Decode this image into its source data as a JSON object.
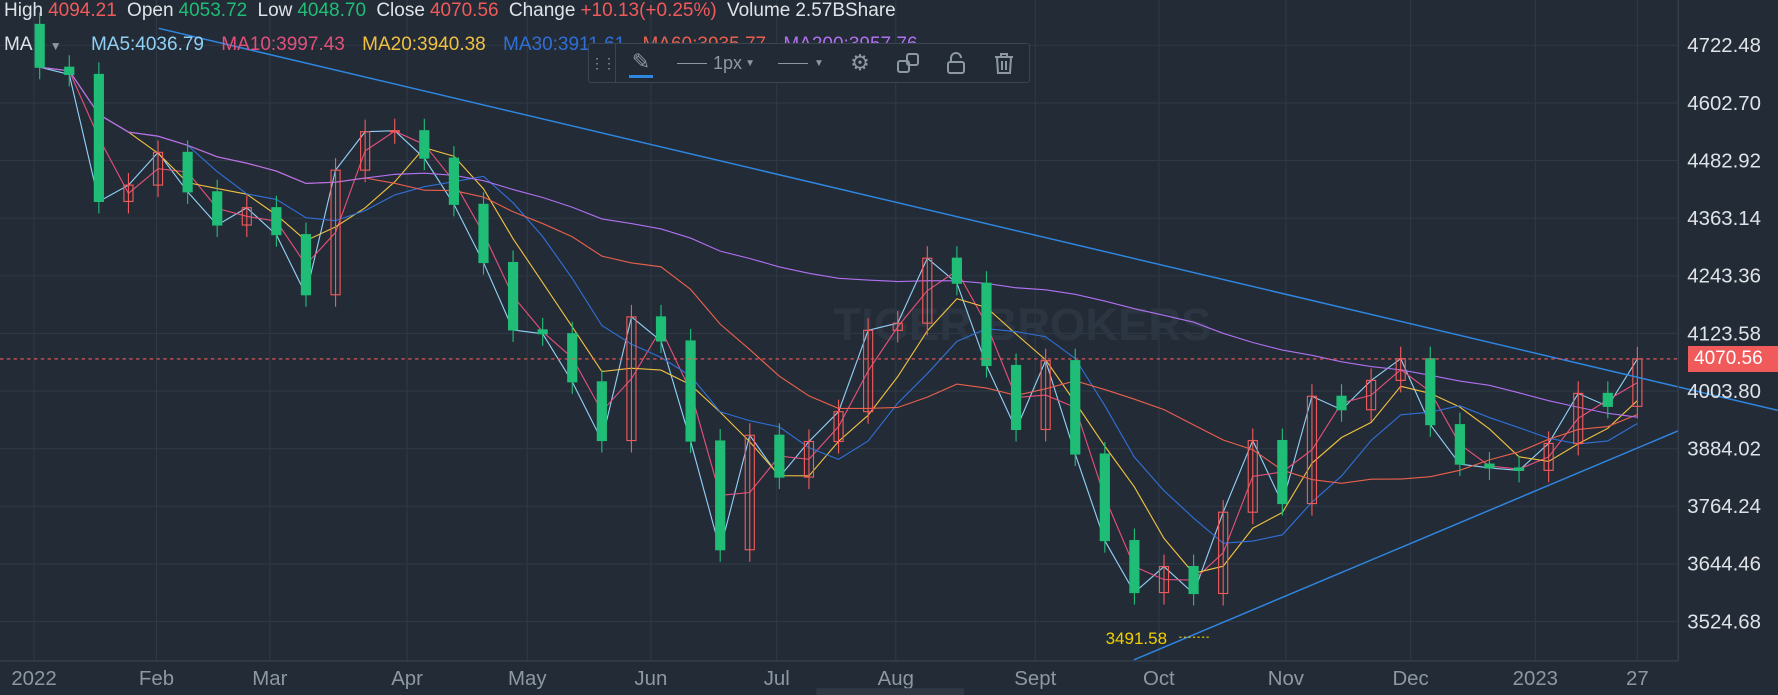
{
  "header": {
    "high_label": "High",
    "high": "4094.21",
    "open_label": "Open",
    "open": "4053.72",
    "low_label": "Low",
    "low": "4048.70",
    "close_label": "Close",
    "close": "4070.56",
    "change_label": "Change",
    "change": "+10.13(+0.25%)",
    "volume_label": "Volume",
    "volume": "2.57BShare"
  },
  "ma_bar": {
    "label": "MA",
    "items": [
      {
        "text": "MA5:4036.79",
        "color": "#8fd0f5"
      },
      {
        "text": "MA10:3997.43",
        "color": "#e2507a"
      },
      {
        "text": "MA20:3940.38",
        "color": "#f0c040"
      },
      {
        "text": "MA30:3911.61",
        "color": "#2f6fd6"
      },
      {
        "text": "MA60:3935.77",
        "color": "#e8604c"
      },
      {
        "text": "MA200:3957.76",
        "color": "#b070f0"
      }
    ]
  },
  "toolbar": {
    "width_label": "1px",
    "icons": [
      "drag-handle",
      "pencil",
      "line-width",
      "line-style",
      "gear",
      "clone",
      "lock",
      "trash"
    ]
  },
  "watermark": "TIGER BROKERS",
  "chart_data": {
    "type": "candlestick",
    "title": "",
    "yticks": [
      "4722.48",
      "4602.70",
      "4482.92",
      "4363.14",
      "4243.36",
      "4123.58",
      "4003.80",
      "3884.02",
      "3764.24",
      "3644.46",
      "3524.68"
    ],
    "ylim": [
      3460,
      4760
    ],
    "xticks": [
      "2022",
      "Feb",
      "Mar",
      "Apr",
      "May",
      "Jun",
      "Jul",
      "Aug",
      "Sept",
      "Oct",
      "Nov",
      "Dec",
      "2023",
      "27"
    ],
    "current_price": "4070.56",
    "low_annotation": "3491.58",
    "closes": [
      4677,
      4662,
      4398,
      4432,
      4500,
      4418,
      4349,
      4385,
      4329,
      4204,
      4463,
      4543,
      4545,
      4488,
      4392,
      4271,
      4131,
      4123,
      4023,
      3901,
      4158,
      4108,
      3900,
      3674,
      3912,
      3825,
      3899,
      3961,
      4130,
      4145,
      4280,
      4228,
      4057,
      3924,
      4067,
      3873,
      3693,
      3585,
      3639,
      3583,
      3752,
      3901,
      3770,
      3993,
      3965,
      4026,
      4071,
      3934,
      3852,
      3844,
      3839,
      3895,
      3999,
      3972,
      4070.56
    ],
    "colors": {
      "up": "#f05a5a",
      "down": "#1fbd76",
      "trendline": "#2f86e0"
    }
  }
}
